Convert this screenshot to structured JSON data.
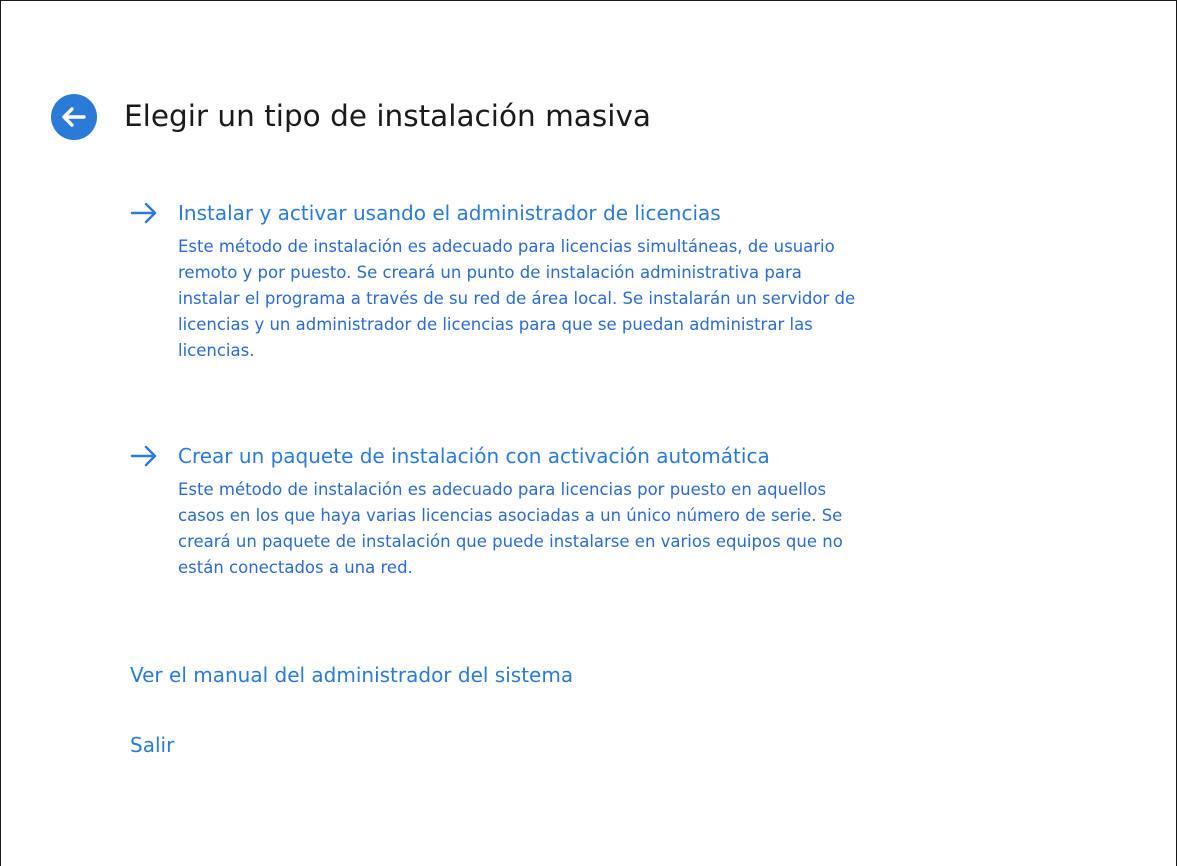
{
  "header": {
    "title": "Elegir un tipo de instalación masiva",
    "back_icon": "arrow-left-circle-icon"
  },
  "options": [
    {
      "icon": "arrow-right-icon",
      "label": "Instalar y activar usando el administrador de licencias",
      "description": "Este método de instalación es adecuado para licencias simultáneas, de usuario\nremoto y por puesto. Se creará un punto de instalación administrativa para\ninstalar el programa a través de su red de área local. Se instalarán un servidor de\nlicencias y un administrador de licencias para que se puedan administrar las\nlicencias."
    },
    {
      "icon": "arrow-right-icon",
      "label": "Crear un paquete de instalación con activación automática",
      "description": "Este método de instalación es adecuado para licencias por puesto en aquellos\ncasos en los que haya varias licencias asociadas a un único número de serie. Se\ncreará un paquete de instalación que puede instalarse en varios equipos que no\nestán conectados a una red."
    }
  ],
  "links": {
    "manual": "Ver el manual del administrador del sistema",
    "exit": "Salir"
  },
  "colors": {
    "accent": "#2a7ad8",
    "title_text": "#1a1a1a",
    "background": "#ffffff"
  }
}
